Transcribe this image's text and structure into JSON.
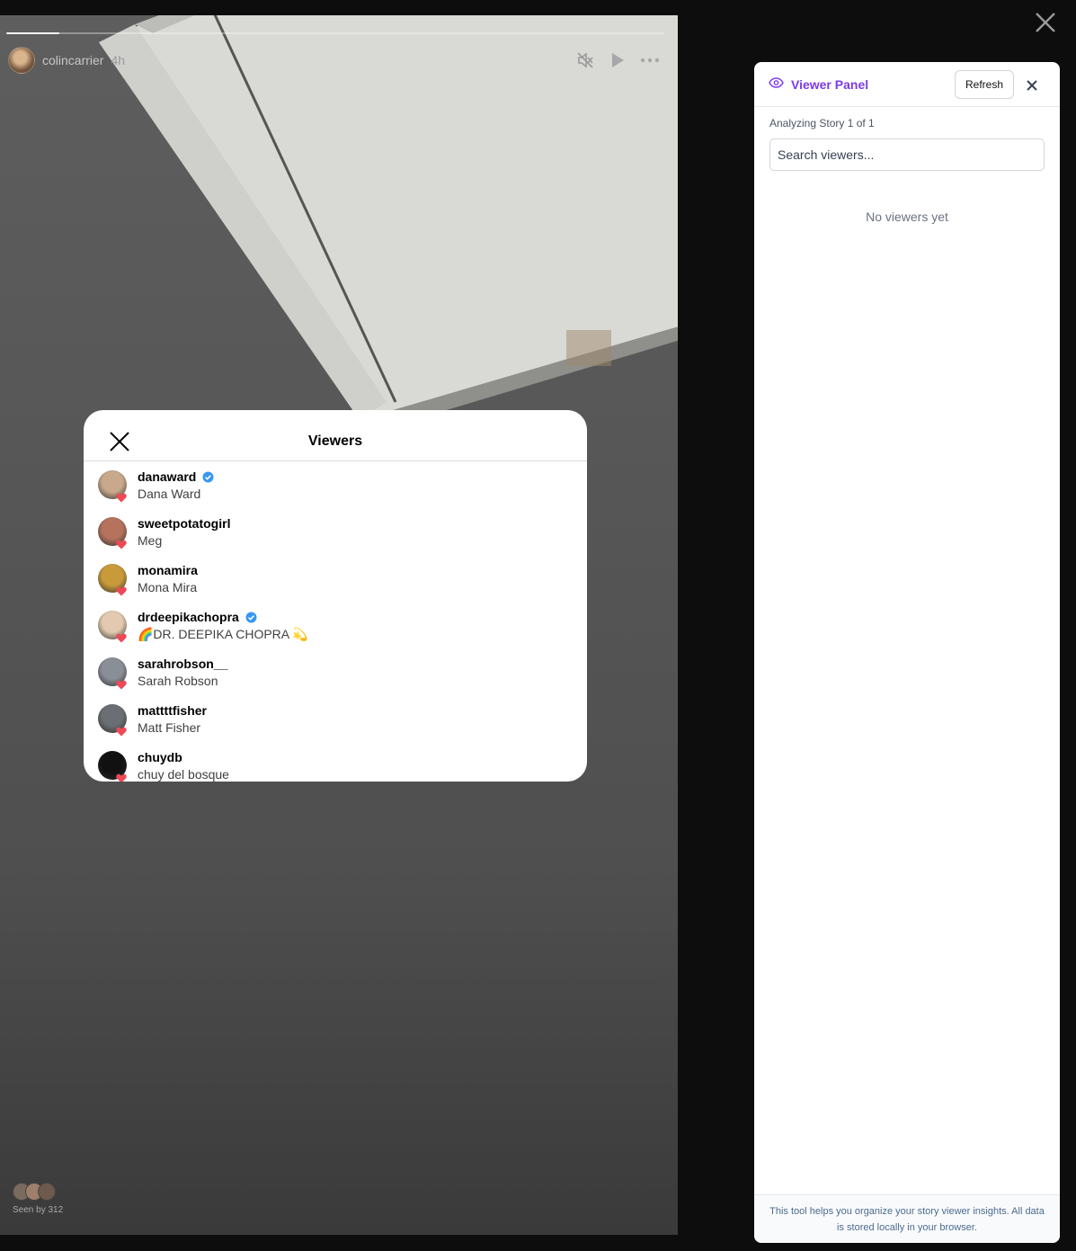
{
  "story": {
    "username": "colincarrier",
    "time": "4h",
    "progress": 0.08,
    "seen_by": "Seen by 312"
  },
  "viewers_modal": {
    "title": "Viewers",
    "viewers": [
      {
        "username": "danaward",
        "name": "Dana Ward",
        "verified": true,
        "avatar_color": "#c9a98c"
      },
      {
        "username": "sweetpotatogirl",
        "name": "Meg",
        "verified": false,
        "avatar_color": "#b5735e"
      },
      {
        "username": "monamira",
        "name": "Mona Mira",
        "verified": false,
        "avatar_color": "#c89a3a"
      },
      {
        "username": "drdeepikachopra",
        "name": "🌈DR. DEEPIKA CHOPRA 💫",
        "verified": true,
        "avatar_color": "#e2c9b0"
      },
      {
        "username": "sarahrobson__",
        "name": "Sarah Robson",
        "verified": false,
        "avatar_color": "#8a8f97"
      },
      {
        "username": "mattttfisher",
        "name": "Matt Fisher",
        "verified": false,
        "avatar_color": "#6b6f73"
      },
      {
        "username": "chuydb",
        "name": "chuy del bosque",
        "verified": false,
        "avatar_color": "#111111"
      }
    ]
  },
  "panel": {
    "title": "Viewer Panel",
    "refresh_label": "Refresh",
    "analyzing": "Analyzing Story 1 of 1",
    "search_placeholder": "Search viewers...",
    "empty_text": "No viewers yet",
    "footer": "This tool helps you organize your story viewer insights. All data is stored locally in your browser.",
    "accent_color": "#7c3aed"
  },
  "icons": [
    "mute-icon",
    "play-icon",
    "more-icon",
    "close-icon",
    "eye-icon",
    "verified-badge-icon",
    "heart-icon"
  ]
}
